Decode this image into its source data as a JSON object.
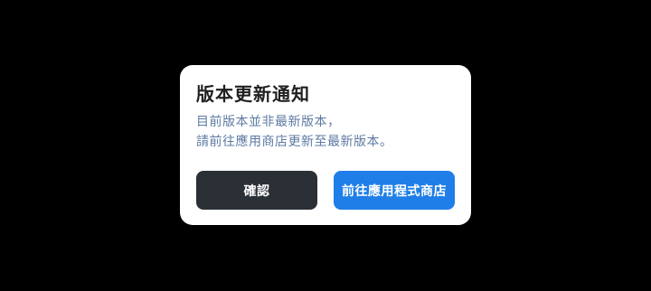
{
  "dialog": {
    "title": "版本更新通知",
    "message_line1": "目前版本並非最新版本，",
    "message_line2": "請前往應用商店更新至最新版本。",
    "confirm_label": "確認",
    "store_label": "前往應用程式商店"
  },
  "colors": {
    "background": "#000000",
    "dialog_bg": "#ffffff",
    "message_text": "#5d7aa3",
    "confirm_button": "#2b2f36",
    "store_button": "#1f7ee8"
  }
}
